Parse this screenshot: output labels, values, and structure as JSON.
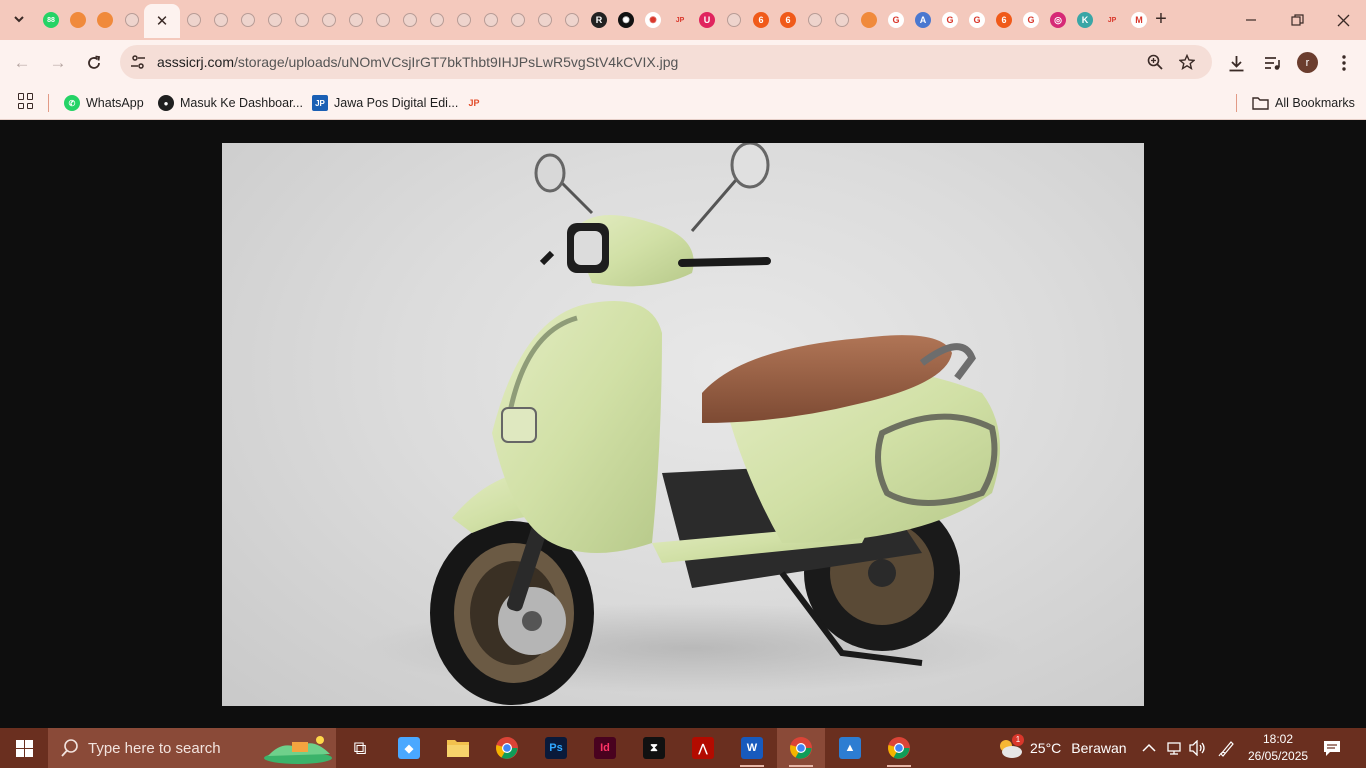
{
  "browser": {
    "url_host": "asssicrj.com",
    "url_path": "/storage/uploads/uNOmVCsjIrGT7bkThbt9IHJPsLwR5vgStV4kCVIX.jpg",
    "profile_initial": "r"
  },
  "tabs": {
    "favicons": [
      {
        "icon": "whatsapp-badge-icon",
        "color": "#25d366",
        "label": "88"
      },
      {
        "icon": "site-orange-icon",
        "color": "#f08a3c",
        "label": ""
      },
      {
        "icon": "site-orange-icon",
        "color": "#f08a3c",
        "label": ""
      },
      {
        "icon": "globe-icon",
        "color": "#b79c96",
        "label": ""
      },
      {
        "icon": "globe-icon",
        "color": "#b79c96",
        "label": ""
      },
      {
        "icon": "globe-icon",
        "color": "#b79c96",
        "label": ""
      },
      {
        "icon": "globe-icon",
        "color": "#b79c96",
        "label": ""
      },
      {
        "icon": "globe-icon",
        "color": "#b79c96",
        "label": ""
      },
      {
        "icon": "globe-icon",
        "color": "#b79c96",
        "label": ""
      },
      {
        "icon": "globe-icon",
        "color": "#b79c96",
        "label": ""
      },
      {
        "icon": "globe-icon",
        "color": "#b79c96",
        "label": ""
      },
      {
        "icon": "globe-icon",
        "color": "#b79c96",
        "label": ""
      },
      {
        "icon": "globe-icon",
        "color": "#b79c96",
        "label": ""
      },
      {
        "icon": "globe-icon",
        "color": "#b79c96",
        "label": ""
      },
      {
        "icon": "globe-icon",
        "color": "#b79c96",
        "label": ""
      },
      {
        "icon": "globe-icon",
        "color": "#b79c96",
        "label": ""
      },
      {
        "icon": "globe-icon",
        "color": "#b79c96",
        "label": ""
      },
      {
        "icon": "globe-icon",
        "color": "#b79c96",
        "label": ""
      },
      {
        "icon": "globe-icon",
        "color": "#b79c96",
        "label": ""
      },
      {
        "icon": "radio-icon",
        "color": "#222222",
        "label": "R"
      },
      {
        "icon": "openai-icon",
        "color": "#111111",
        "label": "✺"
      },
      {
        "icon": "openai-icon",
        "color": "#ffffff",
        "label": "✺"
      },
      {
        "icon": "jp-icon",
        "color": "#f4c9bd",
        "label": "JP"
      },
      {
        "icon": "u-icon",
        "color": "#e0245e",
        "label": "U"
      },
      {
        "icon": "globe-icon",
        "color": "#b79c96",
        "label": ""
      },
      {
        "icon": "six-icon",
        "color": "#f05a1a",
        "label": "6"
      },
      {
        "icon": "six-icon",
        "color": "#f05a1a",
        "label": "6"
      },
      {
        "icon": "globe-icon",
        "color": "#b79c96",
        "label": ""
      },
      {
        "icon": "globe-icon",
        "color": "#b79c96",
        "label": ""
      },
      {
        "icon": "site-orange-icon",
        "color": "#f08a3c",
        "label": ""
      },
      {
        "icon": "google-icon",
        "color": "#ffffff",
        "label": "G"
      },
      {
        "icon": "translate-icon",
        "color": "#4a78d0",
        "label": "A"
      },
      {
        "icon": "google-icon",
        "color": "#ffffff",
        "label": "G"
      },
      {
        "icon": "google-icon",
        "color": "#ffffff",
        "label": "G"
      },
      {
        "icon": "six-icon",
        "color": "#f05a1a",
        "label": "6"
      },
      {
        "icon": "google-icon",
        "color": "#ffffff",
        "label": "G"
      },
      {
        "icon": "instagram-icon",
        "color": "#d62976",
        "label": "◎"
      },
      {
        "icon": "k-icon",
        "color": "#3aa6a6",
        "label": "K"
      },
      {
        "icon": "jp-icon",
        "color": "#f4c9bd",
        "label": "JP"
      },
      {
        "icon": "gmail-icon",
        "color": "#ffffff",
        "label": "M"
      }
    ],
    "active_close_glyph": "✕"
  },
  "bookmarks": [
    {
      "label": "WhatsApp",
      "icon": "whatsapp-icon",
      "color": "#25d366",
      "glyph": "✆"
    },
    {
      "label": "Masuk Ke Dashboar...",
      "icon": "github-icon",
      "color": "#1f1f1f",
      "glyph": "●"
    },
    {
      "label": "Jawa Pos Digital Edi...",
      "icon": "jawapos-icon",
      "color": "#1a5fb4",
      "glyph": "JP"
    },
    {
      "label": "",
      "icon": "jp-icon",
      "color": "#f4c9bd",
      "glyph": "JP"
    }
  ],
  "all_bookmarks_label": "All Bookmarks",
  "taskbar": {
    "search_placeholder": "Type here to search",
    "apps": [
      {
        "name": "task-view",
        "icon": "task-view-icon",
        "color": "#ffffff",
        "glyph": "⧉",
        "running": false
      },
      {
        "name": "copilot",
        "icon": "copilot-icon",
        "color": "#4aa8ff",
        "glyph": "◆",
        "running": false
      },
      {
        "name": "file-explorer",
        "icon": "folder-icon",
        "color": "#f2c14e",
        "glyph": "",
        "running": false
      },
      {
        "name": "chrome",
        "icon": "chrome-icon",
        "color": "#db4437",
        "glyph": "",
        "running": false
      },
      {
        "name": "photoshop",
        "icon": "photoshop-icon",
        "color": "#0a1a3a",
        "glyph": "Ps",
        "running": false
      },
      {
        "name": "indesign",
        "icon": "indesign-icon",
        "color": "#49021f",
        "glyph": "Id",
        "running": false
      },
      {
        "name": "capcut",
        "icon": "capcut-icon",
        "color": "#111111",
        "glyph": "⧗",
        "running": false
      },
      {
        "name": "acrobat",
        "icon": "acrobat-icon",
        "color": "#b30b00",
        "glyph": "⋀",
        "running": false
      },
      {
        "name": "word",
        "icon": "word-icon",
        "color": "#185abd",
        "glyph": "W",
        "running": true
      },
      {
        "name": "chrome-profile-r",
        "icon": "chrome-icon",
        "color": "#db4437",
        "glyph": "",
        "running": true
      },
      {
        "name": "photos",
        "icon": "photos-icon",
        "color": "#2d7dd2",
        "glyph": "▲",
        "running": false
      },
      {
        "name": "chrome-profile-h",
        "icon": "chrome-icon",
        "color": "#db4437",
        "glyph": "",
        "running": true
      }
    ],
    "weather_temp": "25°C",
    "weather_desc": "Berawan",
    "weather_badge": "1",
    "time": "18:02",
    "date": "26/05/2025"
  }
}
